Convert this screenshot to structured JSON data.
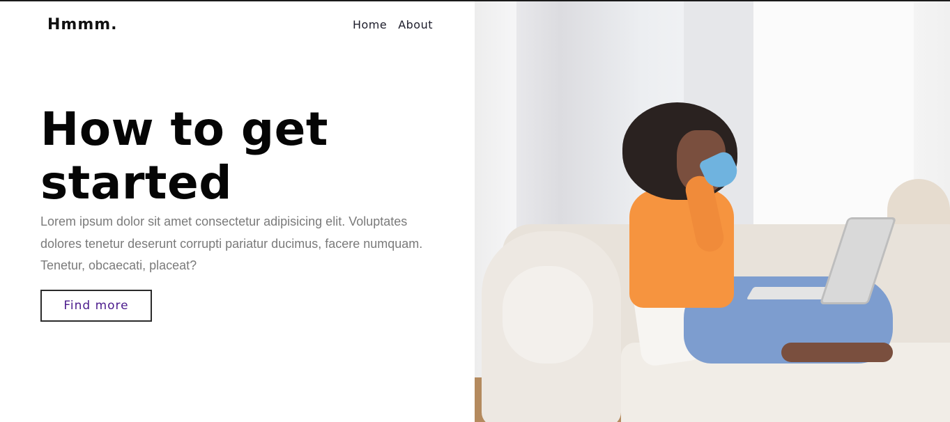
{
  "brand": {
    "logo": "Hmmm."
  },
  "nav": {
    "items": [
      {
        "label": "Home"
      },
      {
        "label": "About"
      }
    ]
  },
  "hero": {
    "title": "How to get started",
    "body": "Lorem ipsum dolor sit amet consectetur adipisicing elit. Voluptates dolores tenetur deserunt corrupti pariatur ducimus, facere numquam. Tenetur, obcaecati, placeat?",
    "cta_label": "Find more"
  },
  "colors": {
    "cta_text": "#4a1a8c",
    "body_text": "#7a7a7a",
    "title": "#050505",
    "border": "#2a2a2a"
  }
}
